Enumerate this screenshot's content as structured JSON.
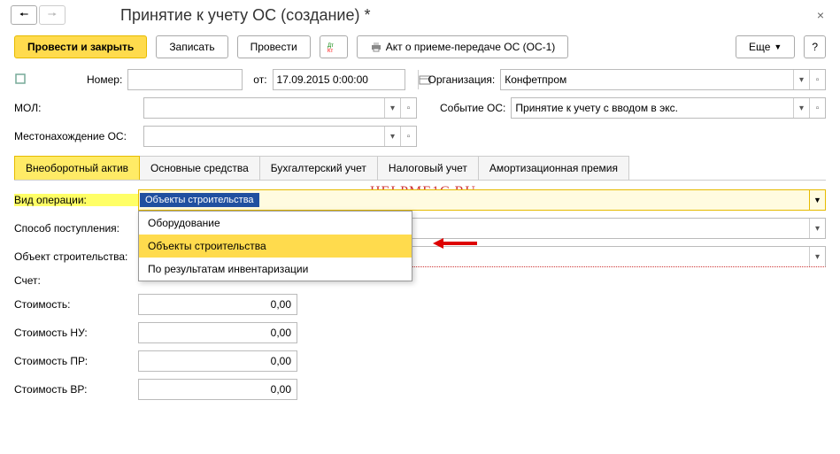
{
  "title": "Принятие к учету ОС (создание) *",
  "toolbar": {
    "post_close": "Провести и закрыть",
    "save": "Записать",
    "post": "Провести",
    "print": "Акт о приеме-передаче ОС (ОС-1)",
    "more": "Еще"
  },
  "form": {
    "number_label": "Номер:",
    "number_value": "",
    "from_label": "от:",
    "date_value": "17.09.2015 0:00:00",
    "org_label": "Организация:",
    "org_value": "Конфетпром",
    "mol_label": "МОЛ:",
    "mol_value": "",
    "event_label": "Событие ОС:",
    "event_value": "Принятие к учету с вводом в экс.",
    "location_label": "Местонахождение ОС:",
    "location_value": ""
  },
  "tabs": [
    "Внеоборотный актив",
    "Основные средства",
    "Бухгалтерский учет",
    "Налоговый учет",
    "Амортизационная премия"
  ],
  "tab0": {
    "op_type_label": "Вид операции:",
    "op_type_value": "Объекты строительства",
    "options": [
      "Оборудование",
      "Объекты строительства",
      "По результатам инвентаризации"
    ],
    "method_label": "Способ поступления:",
    "object_label": "Объект строительства:",
    "account_label": "Счет:",
    "cost_label": "Стоимость:",
    "cost_nu_label": "Стоимость НУ:",
    "cost_pr_label": "Стоимость ПР:",
    "cost_vr_label": "Стоимость ВР:",
    "zero": "0,00"
  },
  "watermark": "HELPME1C.RU"
}
